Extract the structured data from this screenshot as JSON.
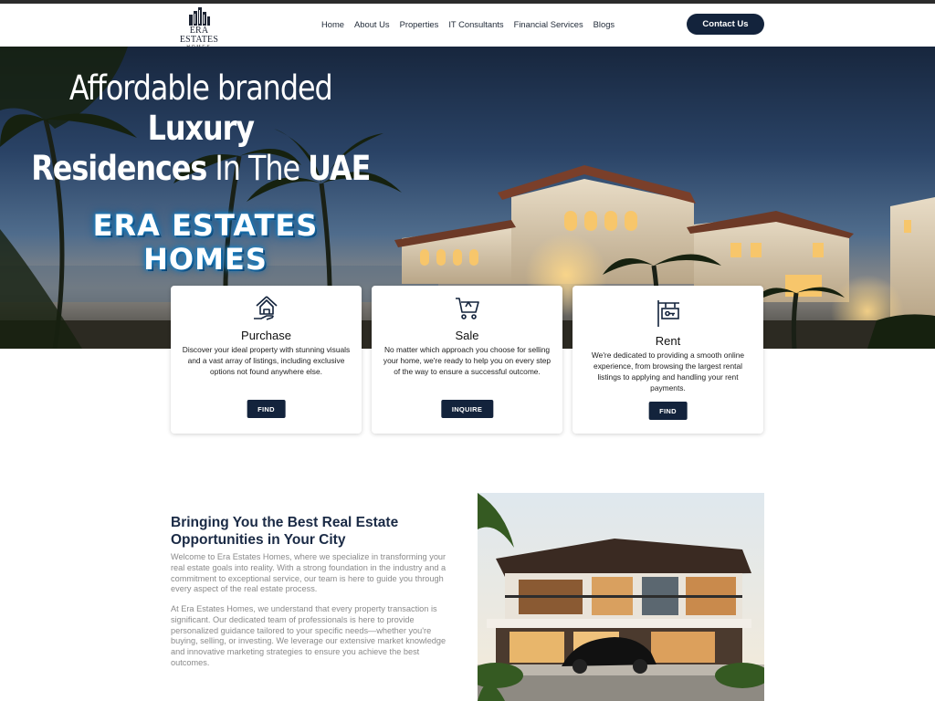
{
  "header": {
    "logo_name": "ERA ESTATES",
    "logo_sub": "HOMES",
    "nav": [
      "Home",
      "About Us",
      "Properties",
      "IT Consultants",
      "Financial Services",
      "Blogs"
    ],
    "contact_label": "Contact Us"
  },
  "hero": {
    "line1_regular": "Affordable branded",
    "line1_bold": "Luxury",
    "line2_bold_a": "Residences",
    "line2_regular": "In The",
    "line2_bold_b": "UAE",
    "brand_line1": "ERA ESTATES",
    "brand_line2": "HOMES"
  },
  "cards": [
    {
      "icon": "house-hand-icon",
      "title": "Purchase",
      "text": "Discover your ideal property with stunning visuals and a vast array of listings, including exclusive options not found anywhere else.",
      "button": "FIND"
    },
    {
      "icon": "shopping-cart-icon",
      "title": "Sale",
      "text": "No matter which approach you choose for selling your home, we're ready to help you on every step of the way to ensure a successful outcome.",
      "button": "INQUIRE"
    },
    {
      "icon": "rent-sign-icon",
      "title": "Rent",
      "text": "We're dedicated to providing a smooth online experience, from browsing the largest rental listings to applying and handling your rent payments.",
      "button": "FIND"
    }
  ],
  "about": {
    "title": "Bringing You the Best Real Estate Opportunities in Your City",
    "p1": "Welcome to Era Estates Homes, where we specialize in transforming your real estate goals into reality. With a strong foundation in the industry and a commitment to exceptional service, our team is here to guide you through every aspect of the real estate process.",
    "p2": "At Era Estates Homes, we understand that every property transaction is significant. Our dedicated team of professionals is here to provide personalized guidance tailored to your specific needs—whether you're buying, selling, or investing. We leverage our extensive market knowledge and innovative marketing strategies to ensure you achieve the best outcomes."
  },
  "colors": {
    "primary": "#13233c",
    "heading": "#1a2a45",
    "body_text": "#8a8a8a",
    "glow": "#1e86c8"
  }
}
